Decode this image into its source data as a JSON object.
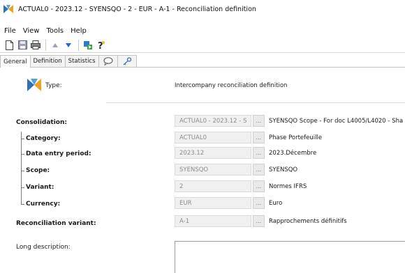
{
  "window": {
    "title": "ACTUAL0 - 2023.12 - SYENSQO - 2 - EUR - A-1 - Reconciliation definition",
    "icon": "app-logo-icon"
  },
  "menu": {
    "items": [
      "File",
      "View",
      "Tools",
      "Help"
    ]
  },
  "toolbar": {
    "buttons": [
      "new-document-icon",
      "save-icon",
      "print-icon",
      "arrow-up-icon",
      "arrow-down-icon",
      "run-icon",
      "help-icon"
    ]
  },
  "tabs": {
    "items": [
      "General",
      "Definition",
      "Statistics"
    ],
    "icon_tabs": [
      "comment-icon",
      "key-icon"
    ],
    "active": "General"
  },
  "type_section": {
    "label": "Type:",
    "value": "Intercompany reconciliation definition"
  },
  "rows": [
    {
      "label": "Consolidation:",
      "value": "ACTUAL0 - 2023.12 - S",
      "button": "...",
      "desc": "SYENSQO Scope - For doc L4005/L4020 - Sha"
    },
    {
      "label": "Category:",
      "value": "ACTUAL0",
      "button": "...",
      "desc": "Phase Portefeuille"
    },
    {
      "label": "Data entry period:",
      "value": "2023.12",
      "button": "...",
      "desc": "2023.Décembre"
    },
    {
      "label": "Scope:",
      "value": "SYENSQO",
      "button": "...",
      "desc": "SYENSQO"
    },
    {
      "label": "Variant:",
      "value": "2",
      "button": "...",
      "desc": "Normes IFRS"
    },
    {
      "label": "Currency:",
      "value": "EUR",
      "button": "...",
      "desc": "Euro"
    },
    {
      "label": "Reconciliation variant:",
      "value": "A-1",
      "button": "...",
      "desc": "Rapprochements définitifs"
    }
  ],
  "long_description": {
    "label": "Long description:",
    "value": ""
  },
  "colors": {
    "field_bg": "#f0f0f0",
    "field_text": "#8a8a8a",
    "tab_border": "#c2c2c2",
    "logo_blue": "#2f6fc0",
    "logo_orange": "#f0a21a"
  }
}
